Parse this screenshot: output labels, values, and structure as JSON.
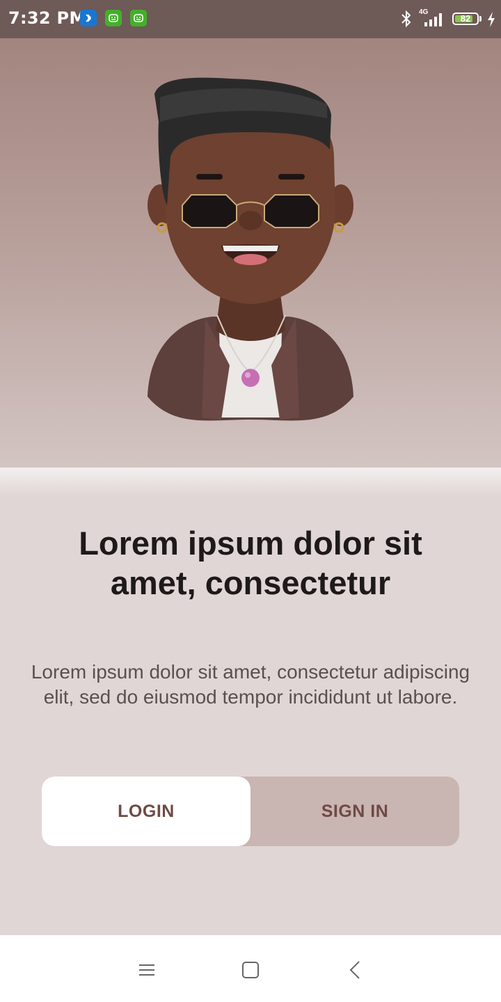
{
  "status_bar": {
    "time": "7:32 PM",
    "network": "4G",
    "battery": "82",
    "battery_level": 0.82,
    "notification_icons": [
      "bluetooth-app-icon",
      "android-app-icon",
      "android-app-icon"
    ]
  },
  "hero": {
    "illustration": "avatar-3d-man-with-sunglasses"
  },
  "content": {
    "headline": "Lorem ipsum dolor sit amet, consectetur",
    "body": "Lorem ipsum dolor sit amet, consectetur adipiscing elit, sed do eiusmod tempor incididunt ut labore."
  },
  "auth_toggle": {
    "login_label": "LOGIN",
    "signin_label": "SIGN IN",
    "selected": "LOGIN"
  },
  "nav_bar": {
    "icons": [
      "menu-icon",
      "home-square-icon",
      "back-chevron-icon"
    ]
  },
  "colors": {
    "status_bar": "#6e5a57",
    "background": "#e0d6d5",
    "toggle_track": "#c9b5b1",
    "button_text": "#6f4a44"
  }
}
